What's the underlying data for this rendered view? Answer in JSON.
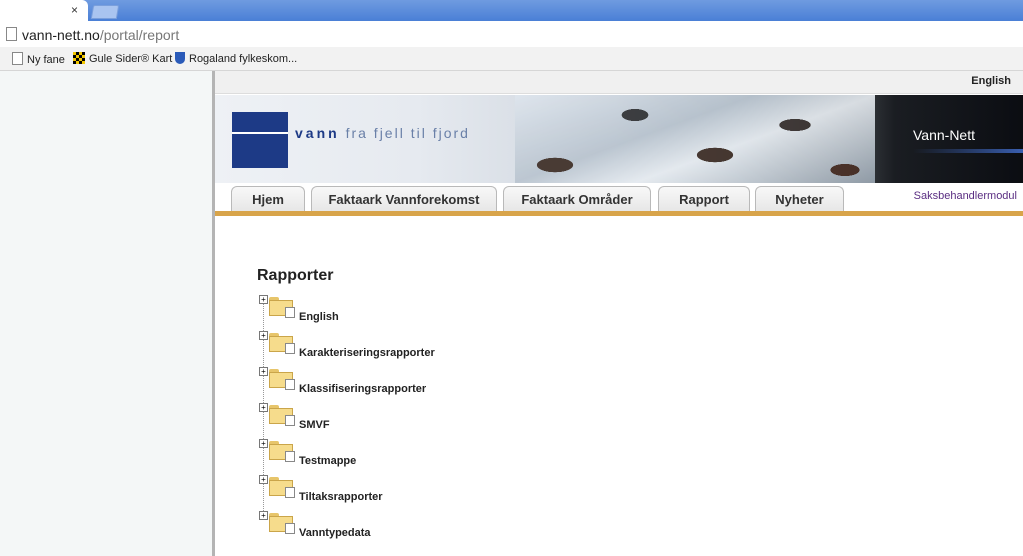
{
  "browser": {
    "tab_close": "×",
    "url_host": "vann-nett.no",
    "url_path": "/portal/report",
    "bookmarks": [
      "Ny fane",
      "Gule Sider® Kart",
      "Rogaland fylkeskom..."
    ]
  },
  "site": {
    "language_link": "English",
    "tagline_bold": "vann",
    "tagline_rest": "fra fjell til fjord",
    "brand": "Vann-Nett",
    "nav": [
      "Hjem",
      "Faktaark Vannforekomst",
      "Faktaark Områder",
      "Rapport",
      "Nyheter"
    ],
    "saks_link": "Saksbehandlermodul"
  },
  "main": {
    "title": "Rapporter",
    "tree_items": [
      "English",
      "Karakteriseringsrapporter",
      "Klassifiseringsrapporter",
      "SMVF",
      "Testmappe",
      "Tiltaksrapporter",
      "Vanntypedata"
    ]
  },
  "colors": {
    "tabstrip": "#4a7fd6",
    "logo": "#1d3a86",
    "nav_underline": "#d8a44a",
    "saks_link": "#5a2d82"
  }
}
